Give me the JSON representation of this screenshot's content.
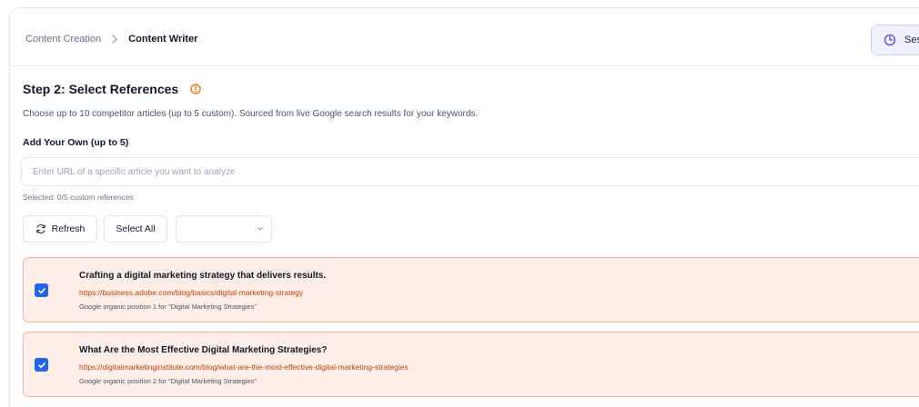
{
  "breadcrumb": {
    "parent": "Content Creation",
    "current": "Content Writer"
  },
  "session_button": {
    "label": "Ses"
  },
  "step": {
    "title": "Step 2: Select References"
  },
  "subtitle": "Choose up to 10 competitor articles (up to 5 custom). Sourced from live Google search results for your keywords.",
  "custom": {
    "label": "Add Your Own (up to 5)",
    "input_value": "",
    "placeholder": "Enter URL of a specific article you want to analyze",
    "selected_text": "Selected: 0/5 custom references"
  },
  "toolbar": {
    "refresh_label": "Refresh",
    "select_all_label": "Select All",
    "filter_value": ""
  },
  "references": [
    {
      "checked": true,
      "title": "Crafting a digital marketing strategy that delivers results.",
      "url": "https://business.adobe.com/blog/basics/digital-marketing-strategy",
      "meta": "Google organic position 1 for \"Digital Marketing Strategies\""
    },
    {
      "checked": true,
      "title": "What Are the Most Effective Digital Marketing Strategies?",
      "url": "https://digitalmarketinginstitute.com/blog/what-are-the-most-effective-digital-marketing-strategies",
      "meta": "Google organic position 2 for \"Digital Marketing Strategies\""
    }
  ],
  "colors": {
    "accent": "#2563eb",
    "reference_bg": "#fdeee8",
    "reference_border": "#f4b8a2",
    "url_text": "#c2410c",
    "info_icon": "#f97316"
  },
  "icons": {
    "breadcrumb_separator": "chevron-right-icon",
    "session": "clock-icon",
    "info": "info-icon",
    "refresh": "refresh-icon",
    "filter": "chevron-down-icon",
    "checkbox": "checkmark-icon"
  }
}
